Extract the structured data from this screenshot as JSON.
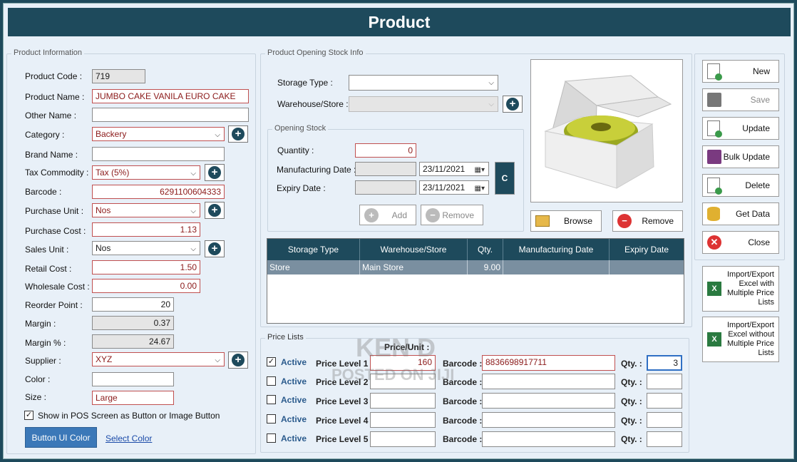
{
  "title": "Product",
  "product_info": {
    "group_label": "Product Information",
    "fields": {
      "product_code": {
        "label": "Product Code :",
        "value": "719"
      },
      "product_name": {
        "label": "Product Name :",
        "value": "JUMBO CAKE VANILA EURO CAKE"
      },
      "other_name": {
        "label": "Other Name :",
        "value": ""
      },
      "category": {
        "label": "Category :",
        "value": "Backery"
      },
      "brand_name": {
        "label": "Brand Name :",
        "value": ""
      },
      "tax_commodity": {
        "label": "Tax Commodity :",
        "value": "Tax (5%)"
      },
      "barcode": {
        "label": "Barcode :",
        "value": "6291100604333"
      },
      "purchase_unit": {
        "label": "Purchase Unit :",
        "value": "Nos"
      },
      "purchase_cost": {
        "label": "Purchase Cost :",
        "value": "1.13"
      },
      "sales_unit": {
        "label": "Sales Unit :",
        "value": "Nos"
      },
      "retail_cost": {
        "label": "Retail Cost :",
        "value": "1.50"
      },
      "wholesale_cost": {
        "label": "Wholesale Cost :",
        "value": "0.00"
      },
      "reorder_point": {
        "label": "Reorder Point :",
        "value": "20"
      },
      "margin": {
        "label": "Margin  :",
        "value": "0.37"
      },
      "margin_pct": {
        "label": "Margin % :",
        "value": "24.67"
      },
      "supplier": {
        "label": "Supplier :",
        "value": "XYZ"
      },
      "color": {
        "label": "Color :",
        "value": ""
      },
      "size": {
        "label": "Size :",
        "value": "Large"
      }
    },
    "show_in_pos_label": "Show in POS Screen as Button or Image Button",
    "show_in_pos_checked": true,
    "button_ui_color": "Button UI Color",
    "select_color": "Select Color"
  },
  "opening_stock_info": {
    "group_label": "Product Opening Stock Info",
    "storage_type_label": "Storage Type :",
    "storage_type_value": "",
    "warehouse_label": "Warehouse/Store :",
    "warehouse_value": "",
    "opening_stock": {
      "group_label": "Opening Stock",
      "quantity_label": "Quantity :",
      "quantity_value": "0",
      "mfg_label": "Manufacturing Date :",
      "mfg_date": "23/11/2021",
      "expiry_label": "Expiry Date :",
      "expiry_date": "23/11/2021",
      "c_button": "C",
      "add_button": "Add",
      "remove_button": "Remove"
    },
    "grid": {
      "headers": [
        "Storage Type",
        "Warehouse/Store",
        "Qty.",
        "Manufacturing Date",
        "Expiry Date"
      ],
      "rows": [
        [
          "Store",
          "Main Store",
          "9.00",
          "",
          ""
        ]
      ]
    }
  },
  "image_panel": {
    "browse_button": "Browse",
    "remove_button": "Remove"
  },
  "actions": {
    "new": "New",
    "save": "Save",
    "update": "Update",
    "bulk_update": "Bulk Update",
    "delete": "Delete",
    "get_data": "Get Data",
    "close": "Close",
    "import_with": "Import/Export Excel with Multiple Price Lists",
    "import_without": "Import/Export Excel without Multiple Price Lists"
  },
  "price_lists": {
    "group_label": "Price Lists",
    "price_unit_header": "Price/Unit :",
    "barcode_label": "Barcode :",
    "qty_label": "Qty. :",
    "active_label": "Active",
    "rows": [
      {
        "level": "Price Level 1 :",
        "active": true,
        "price": "160",
        "barcode": "8836698917711",
        "qty": "3"
      },
      {
        "level": "Price Level 2 :",
        "active": false,
        "price": "",
        "barcode": "",
        "qty": ""
      },
      {
        "level": "Price Level 3 :",
        "active": false,
        "price": "",
        "barcode": "",
        "qty": ""
      },
      {
        "level": "Price Level 4 :",
        "active": false,
        "price": "",
        "barcode": "",
        "qty": ""
      },
      {
        "level": "Price Level 5 :",
        "active": false,
        "price": "",
        "barcode": "",
        "qty": ""
      }
    ]
  },
  "watermark": {
    "line1": "KEN D",
    "line2": "POSTED ON JIJI"
  }
}
